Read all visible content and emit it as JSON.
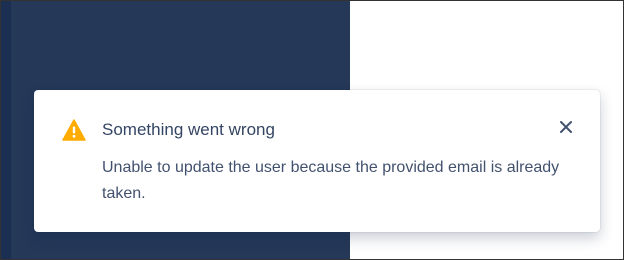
{
  "toast": {
    "title": "Something went wrong",
    "message": "Unable to update the user because the provided email is already taken.",
    "icon": "warning-icon",
    "close_icon": "close-icon",
    "colors": {
      "warning": "#ffab00",
      "title": "#344563",
      "message": "#42526e"
    }
  },
  "background": {
    "dark_panel_color": "#253858",
    "sidebar_color": "#1b2f52"
  }
}
